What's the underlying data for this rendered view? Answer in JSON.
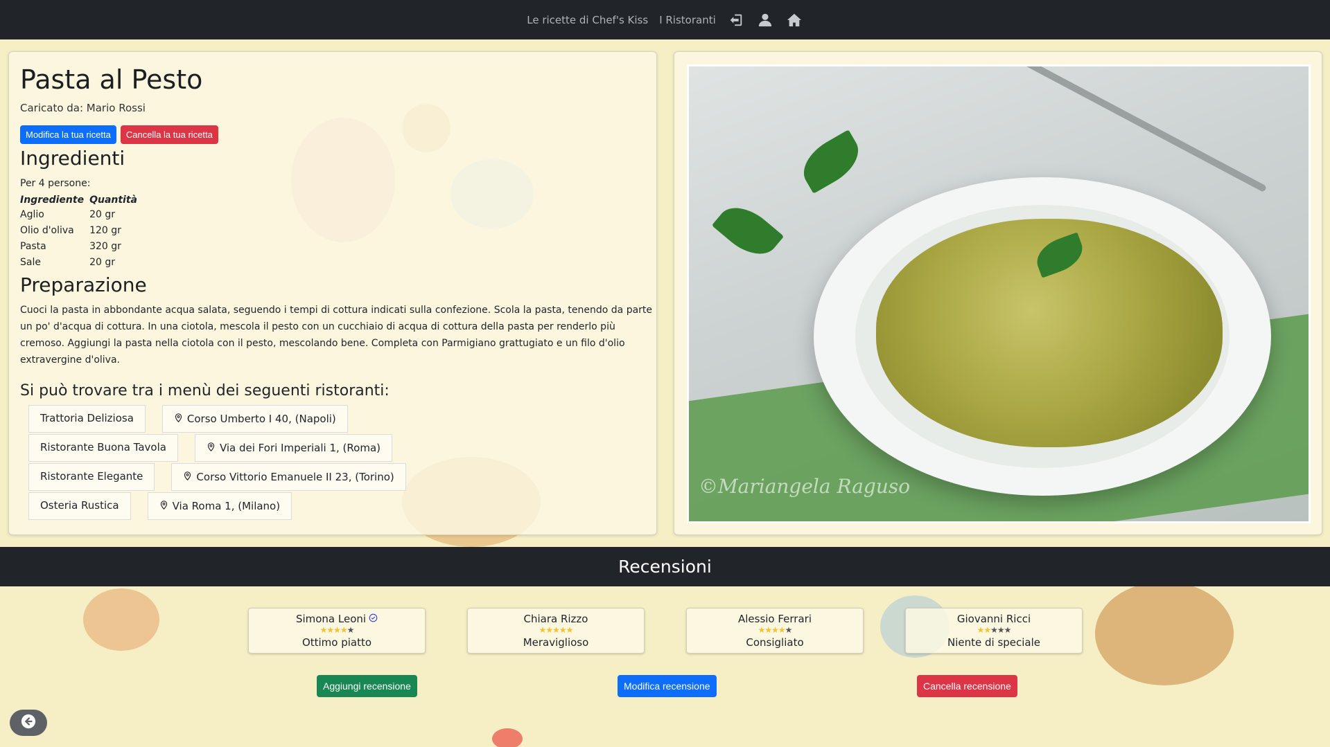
{
  "navbar": {
    "recipes_link": "Le ricette di Chef's Kiss",
    "restaurants_link": "I Ristoranti",
    "icons": [
      "logout-icon",
      "user-icon",
      "home-icon"
    ]
  },
  "recipe": {
    "title": "Pasta al Pesto",
    "uploader": "Caricato da: Mario Rossi",
    "edit_button": "Modifica la tua ricetta",
    "delete_button": "Cancella la tua ricetta",
    "ingredients_heading": "Ingredienti",
    "persons": "Per 4 persone:",
    "table_headers": [
      "Ingrediente",
      "Quantità"
    ],
    "ingredients": [
      {
        "name": "Aglio",
        "qty": "20 gr"
      },
      {
        "name": "Olio d'oliva",
        "qty": "120 gr"
      },
      {
        "name": "Pasta",
        "qty": "320 gr"
      },
      {
        "name": "Sale",
        "qty": "20 gr"
      }
    ],
    "preparation_heading": "Preparazione",
    "preparation_text": "Cuoci la pasta in abbondante acqua salata, seguendo i tempi di cottura indicati sulla confezione. Scola la pasta, tenendo da parte un po' d'acqua di cottura. In una ciotola, mescola il pesto con un cucchiaio di acqua di cottura della pasta per renderlo più cremoso. Aggiungi la pasta nella ciotola con il pesto, mescolando bene. Completa con Parmigiano grattugiato e un filo d'olio extravergine d'oliva.",
    "restaurants_heading": "Si può trovare tra i menù dei seguenti ristoranti:",
    "restaurants": [
      {
        "name": "Trattoria Deliziosa",
        "address": "Corso Umberto I 40, (Napoli)"
      },
      {
        "name": "Ristorante Buona Tavola",
        "address": "Via dei Fori Imperiali 1, (Roma)"
      },
      {
        "name": "Ristorante Elegante",
        "address": "Corso Vittorio Emanuele II 23, (Torino)"
      },
      {
        "name": "Osteria Rustica",
        "address": "Via Roma 1, (Milano)"
      }
    ],
    "photo_watermark": "©Mariangela Raguso"
  },
  "reviews": {
    "heading": "Recensioni",
    "items": [
      {
        "author": "Simona Leoni",
        "verified": true,
        "rating": 4,
        "text": "Ottimo piatto"
      },
      {
        "author": "Chiara Rizzo",
        "verified": false,
        "rating": 5,
        "text": "Meraviglioso"
      },
      {
        "author": "Alessio Ferrari",
        "verified": false,
        "rating": 4,
        "text": "Consigliato"
      },
      {
        "author": "Giovanni Ricci",
        "verified": false,
        "rating": 2,
        "text": "Niente di speciale"
      }
    ],
    "add_button": "Aggiungi recensione",
    "edit_button": "Modifica recensione",
    "delete_button": "Cancella recensione"
  },
  "colors": {
    "primary": "#0d6efd",
    "danger": "#dc3545",
    "success": "#198754",
    "dark": "#212529",
    "background": "#f6efc6"
  }
}
